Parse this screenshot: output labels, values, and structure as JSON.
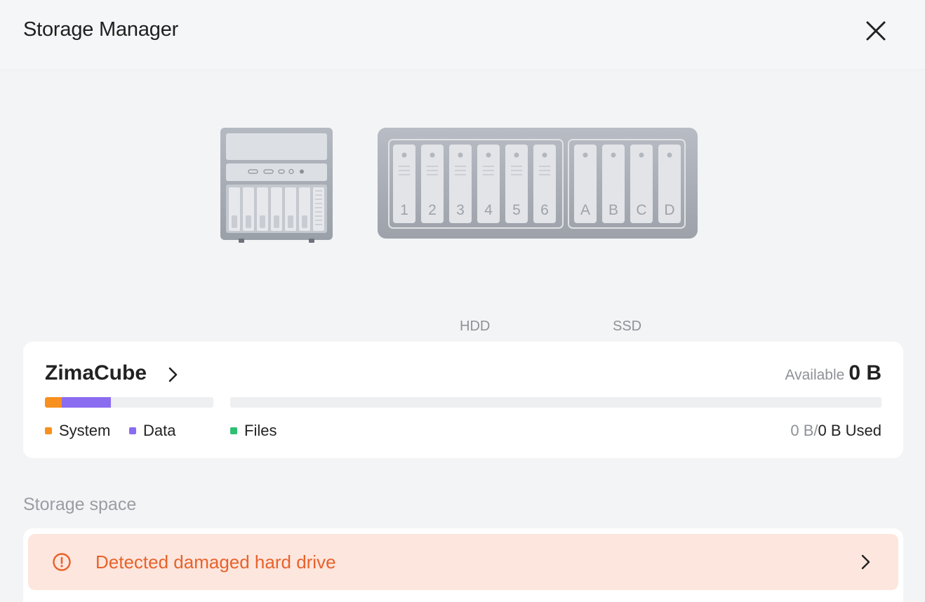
{
  "window": {
    "title": "Storage Manager"
  },
  "devices": {
    "hdd_slots": [
      "1",
      "2",
      "3",
      "4",
      "5",
      "6"
    ],
    "ssd_slots": [
      "A",
      "B",
      "C",
      "D"
    ],
    "hdd_label": "HDD",
    "ssd_label": "SSD"
  },
  "storage_card": {
    "name": "ZimaCube",
    "available_label": "Available",
    "available_value": "0 B",
    "legend": {
      "system": "System",
      "data": "Data",
      "files": "Files"
    },
    "used_part": "0 B/",
    "used_total": "0 B Used",
    "colors": {
      "system": "#f7901e",
      "data": "#8a6cf0",
      "files": "#2fbf71"
    }
  },
  "storage_space": {
    "section_label": "Storage space",
    "alert_text": "Detected damaged hard drive",
    "alert_color": "#e8622c"
  },
  "icons": {
    "close": "close-icon",
    "card_chevron": "chevron-right-icon",
    "alert": "exclamation-circle-icon",
    "alert_chevron": "chevron-right-icon"
  }
}
